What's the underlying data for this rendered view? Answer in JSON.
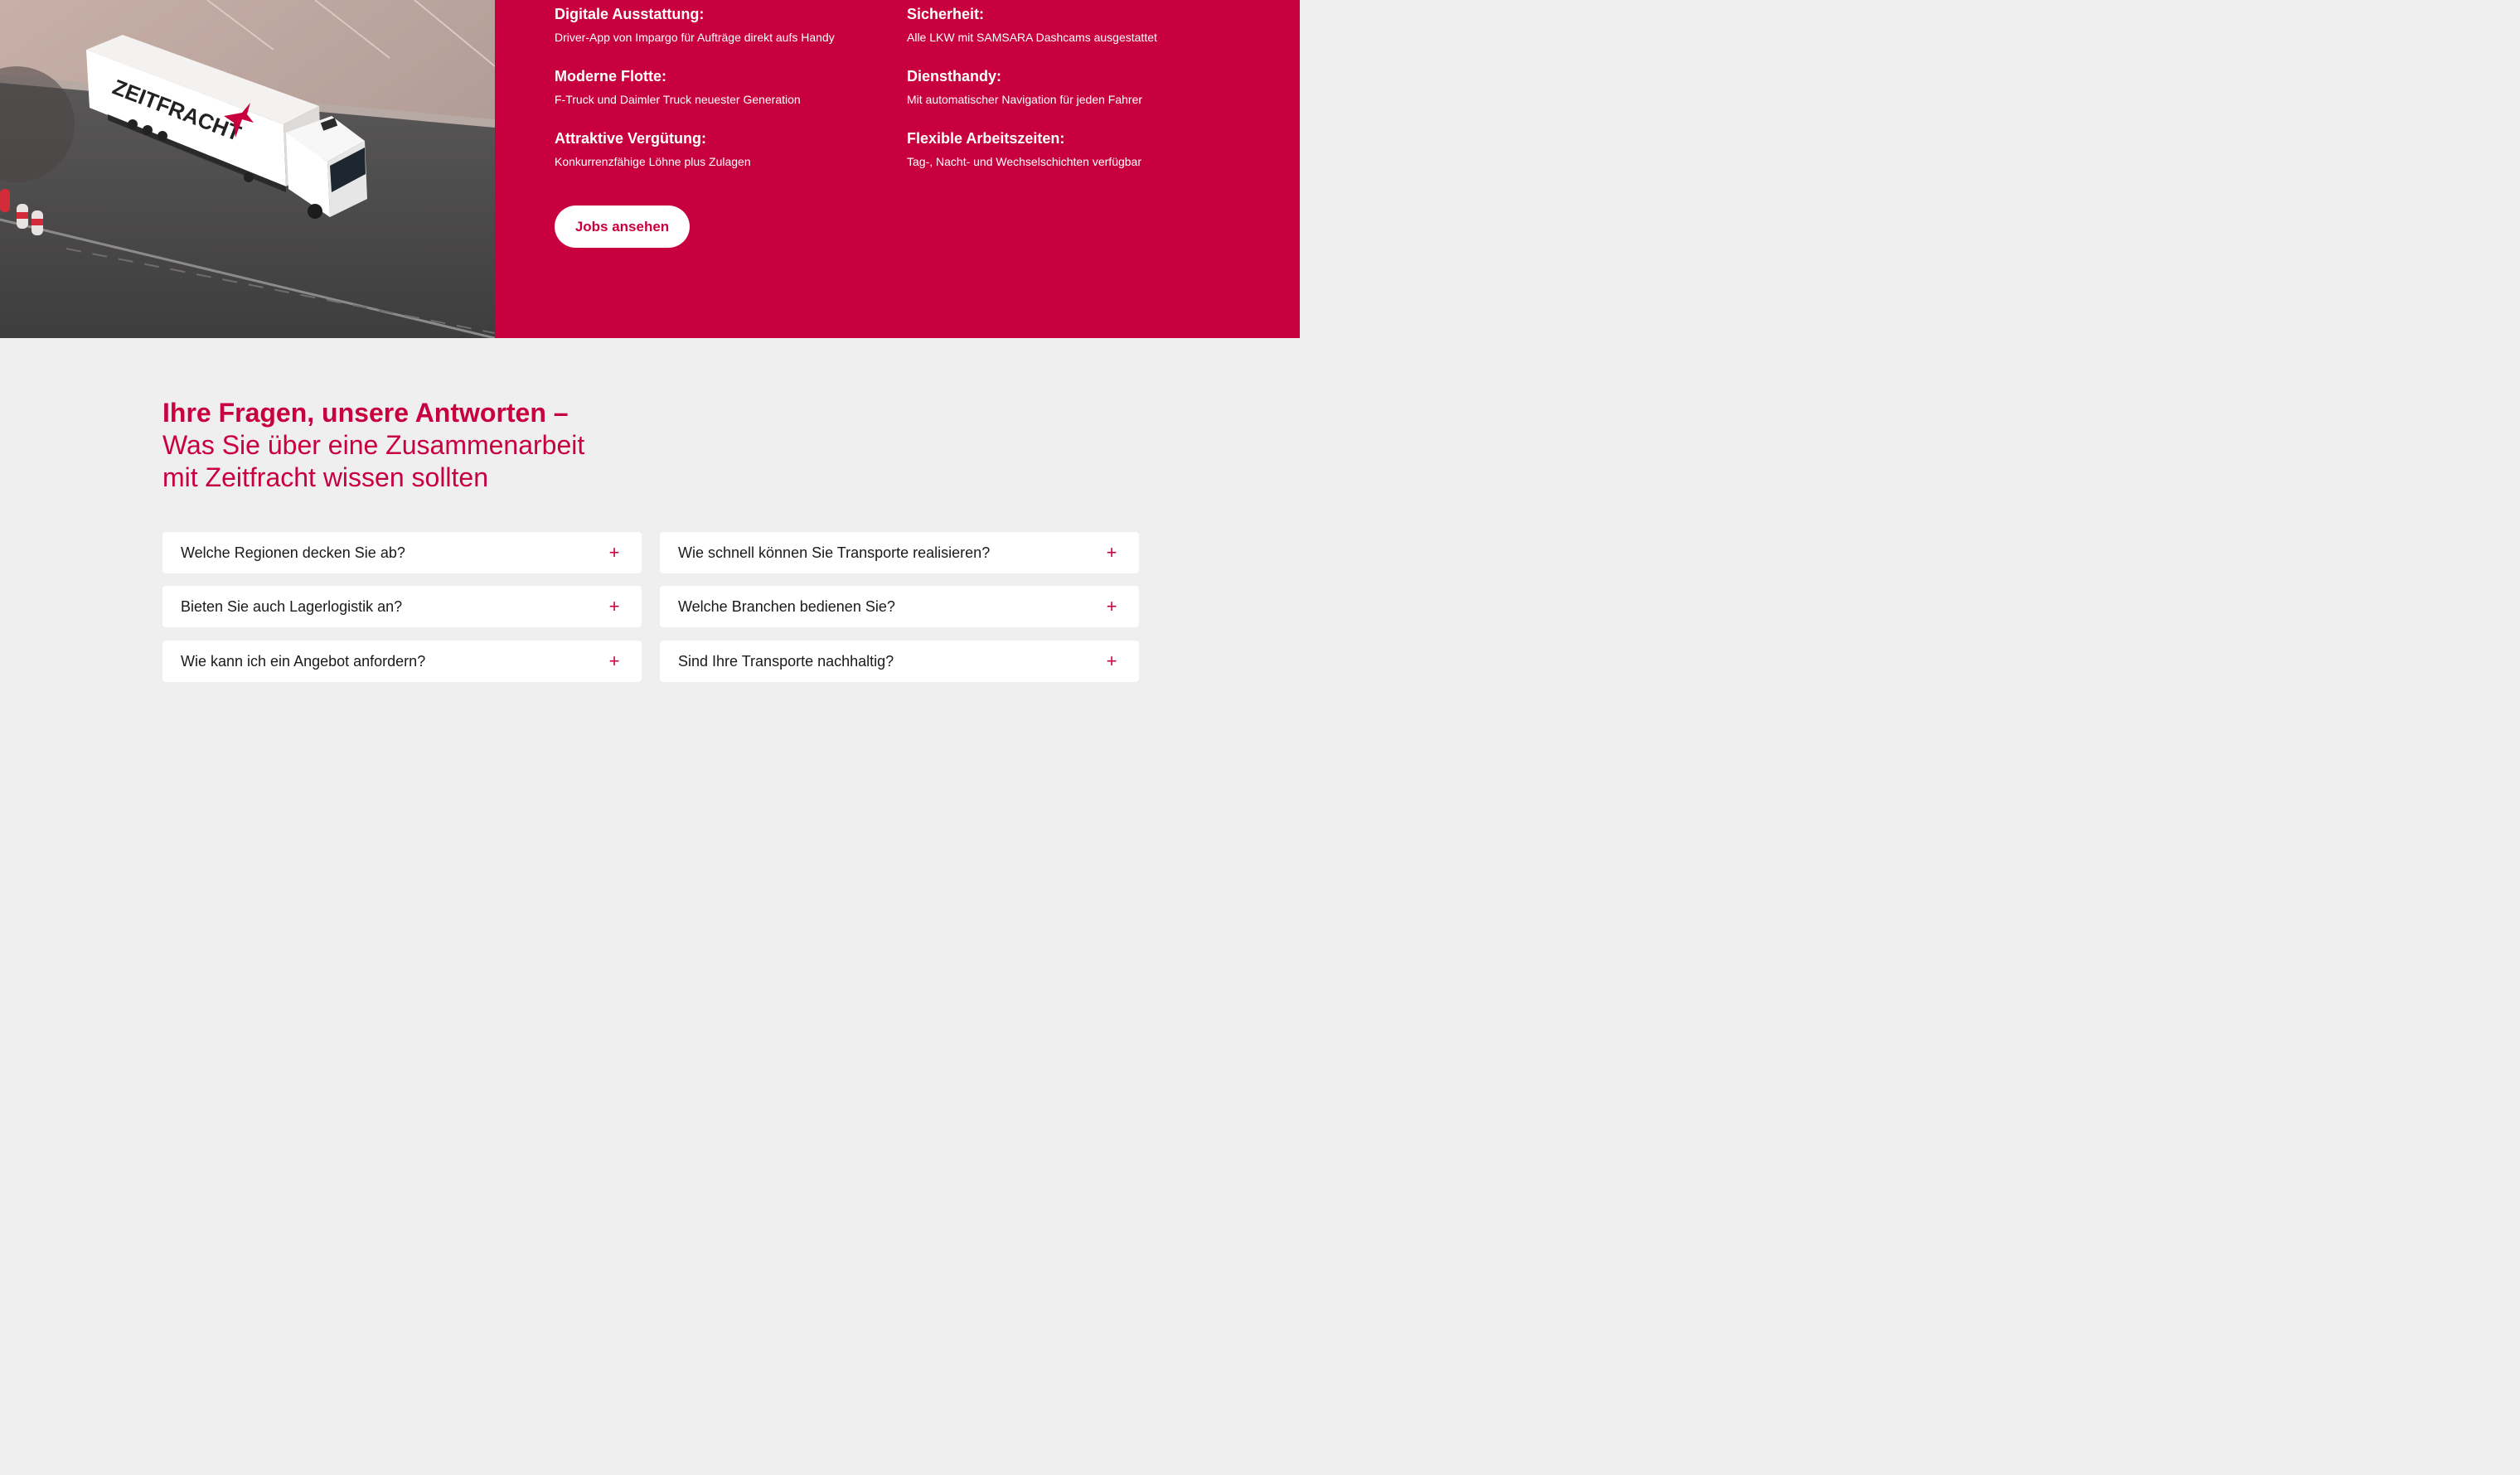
{
  "hero": {
    "image_alt": "Zeitfracht truck on road (aerial)",
    "truck_logo_text": "ZEITFRACHT",
    "features": [
      {
        "title": "Digitale Ausstattung:",
        "text": "Driver-App von Impargo für Aufträge direkt aufs Handy"
      },
      {
        "title": "Sicherheit:",
        "text": "Alle LKW mit SAMSARA Dashcams ausgestattet"
      },
      {
        "title": "Moderne Flotte:",
        "text": "F-Truck und Daimler Truck neuester Generation"
      },
      {
        "title": "Diensthandy:",
        "text": "Mit automatischer Navigation für jeden Fahrer"
      },
      {
        "title": "Attraktive Vergütung:",
        "text": "Konkurrenzfähige Löhne plus Zulagen"
      },
      {
        "title": "Flexible Arbeitszeiten:",
        "text": "Tag-, Nacht- und Wechselschichten verfügbar"
      }
    ],
    "button_label": "Jobs ansehen"
  },
  "faq": {
    "heading_strong": "Ihre Fragen, unsere Antworten –",
    "heading_sub": "Was Sie über eine Zusammenarbeit mit Zeitfracht wissen sollten",
    "expand_icon": "plus-icon",
    "items": [
      {
        "question": "Welche Regionen decken Sie ab?",
        "icon": "+"
      },
      {
        "question": "Wie schnell können Sie Transporte realisieren?",
        "icon": "+"
      },
      {
        "question": "Bieten Sie auch Lagerlogistik an?",
        "icon": "+"
      },
      {
        "question": "Welche Branchen bedienen Sie?",
        "icon": "+"
      },
      {
        "question": "Wie kann ich ein Angebot anfordern?",
        "icon": "+"
      },
      {
        "question": "Sind Ihre Transporte nachhaltig?",
        "icon": "+"
      }
    ]
  },
  "colors": {
    "brand": "#c8003f",
    "background": "#efefef",
    "card": "#ffffff"
  }
}
